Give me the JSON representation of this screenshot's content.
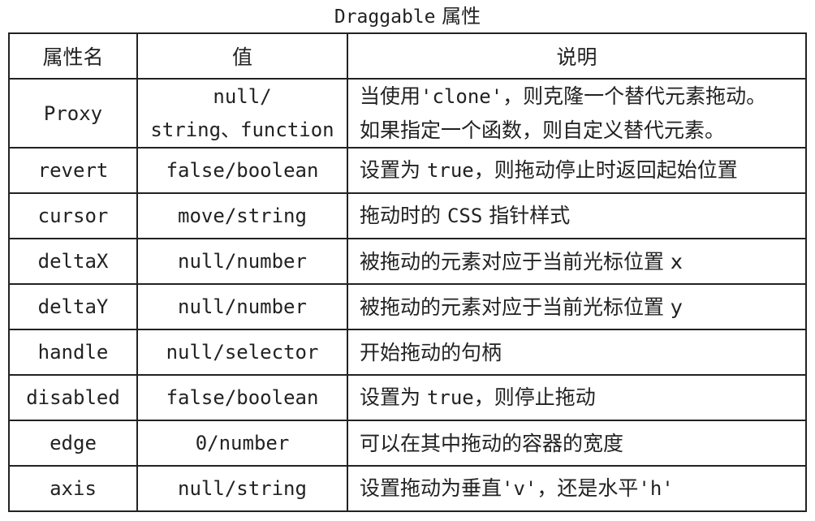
{
  "caption": {
    "code": "Draggable",
    "text": " 属性"
  },
  "table": {
    "headers": [
      "属性名",
      "值",
      "说明"
    ],
    "rows": [
      {
        "name": "Proxy",
        "value_line1": "null/",
        "value_line2": "string、function",
        "desc_line1_a": "当使用",
        "desc_line1_code": "'clone'",
        "desc_line1_b": "，则克隆一个替代元素拖动。",
        "desc_line2": "如果指定一个函数，则自定义替代元素。"
      },
      {
        "name": "revert",
        "value": "false/boolean",
        "desc_a": "设置为 ",
        "desc_code": "true",
        "desc_b": "，则拖动停止时返回起始位置"
      },
      {
        "name": "cursor",
        "value": "move/string",
        "desc_a": "拖动时的 ",
        "desc_code": "CSS",
        "desc_b": " 指针样式"
      },
      {
        "name": "deltaX",
        "value": "null/number",
        "desc": "被拖动的元素对应于当前光标位置 x"
      },
      {
        "name": "deltaY",
        "value": "null/number",
        "desc": "被拖动的元素对应于当前光标位置 y"
      },
      {
        "name": "handle",
        "value": "null/selector",
        "desc": "开始拖动的句柄"
      },
      {
        "name": "disabled",
        "value": "false/boolean",
        "desc_a": "设置为 ",
        "desc_code": "true",
        "desc_b": "，则停止拖动"
      },
      {
        "name": "edge",
        "value": "0/number",
        "desc": "可以在其中拖动的容器的宽度"
      },
      {
        "name": "axis",
        "value": "null/string",
        "desc_a": "设置拖动为垂直",
        "desc_code": "'v'",
        "desc_b": "，还是水平",
        "desc_code2": "'h'"
      }
    ]
  }
}
